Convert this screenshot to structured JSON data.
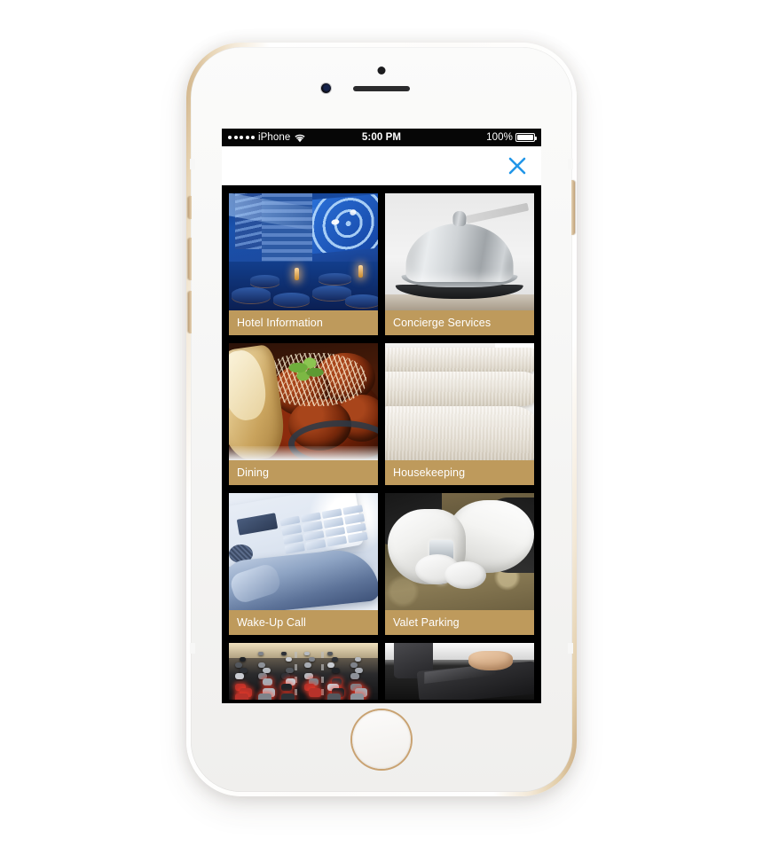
{
  "device": {
    "type": "iphone-6-gold",
    "frame_color": "#C9A97C",
    "body_color": "#F6F6F5",
    "home_button_ring_color": "#C9A271"
  },
  "statusbar": {
    "signal_dots": 5,
    "carrier": "iPhone",
    "wifi_icon": "wifi-icon",
    "time": "5:00 PM",
    "battery_percent": "100%",
    "battery_level": 100,
    "background": "#060606",
    "text_color": "#FFFFFF"
  },
  "navbar": {
    "close_label": "×",
    "close_icon": "close-x-icon",
    "close_color": "#2196E8",
    "background": "#FFFFFF"
  },
  "grid": {
    "background": "#000000",
    "label_background": "#BE9A5C",
    "label_text_color": "#FFFFFF",
    "columns": 2,
    "tiles": [
      {
        "label": "Hotel Information",
        "image": "hotel-lobby-atrium-blue-lit",
        "scene": "lobby"
      },
      {
        "label": "Concierge Services",
        "image": "silver-service-bell-on-desk",
        "scene": "bell"
      },
      {
        "label": "Dining",
        "image": "meatballs-marinara-garlic-bread",
        "scene": "food"
      },
      {
        "label": "Housekeeping",
        "image": "stacked-white-folded-towels",
        "scene": "towels"
      },
      {
        "label": "Wake-Up Call",
        "image": "blue-desk-telephone-handset",
        "scene": "phone-img"
      },
      {
        "label": "Valet Parking",
        "image": "white-gloved-hands-car-keys",
        "scene": "valet"
      },
      {
        "label": "",
        "image": "highway-traffic-cars-aerial",
        "scene": "traffic",
        "partial": true
      },
      {
        "label": "",
        "image": "bellhop-carrying-luggage-bag",
        "scene": "lugg",
        "partial": true
      }
    ]
  }
}
